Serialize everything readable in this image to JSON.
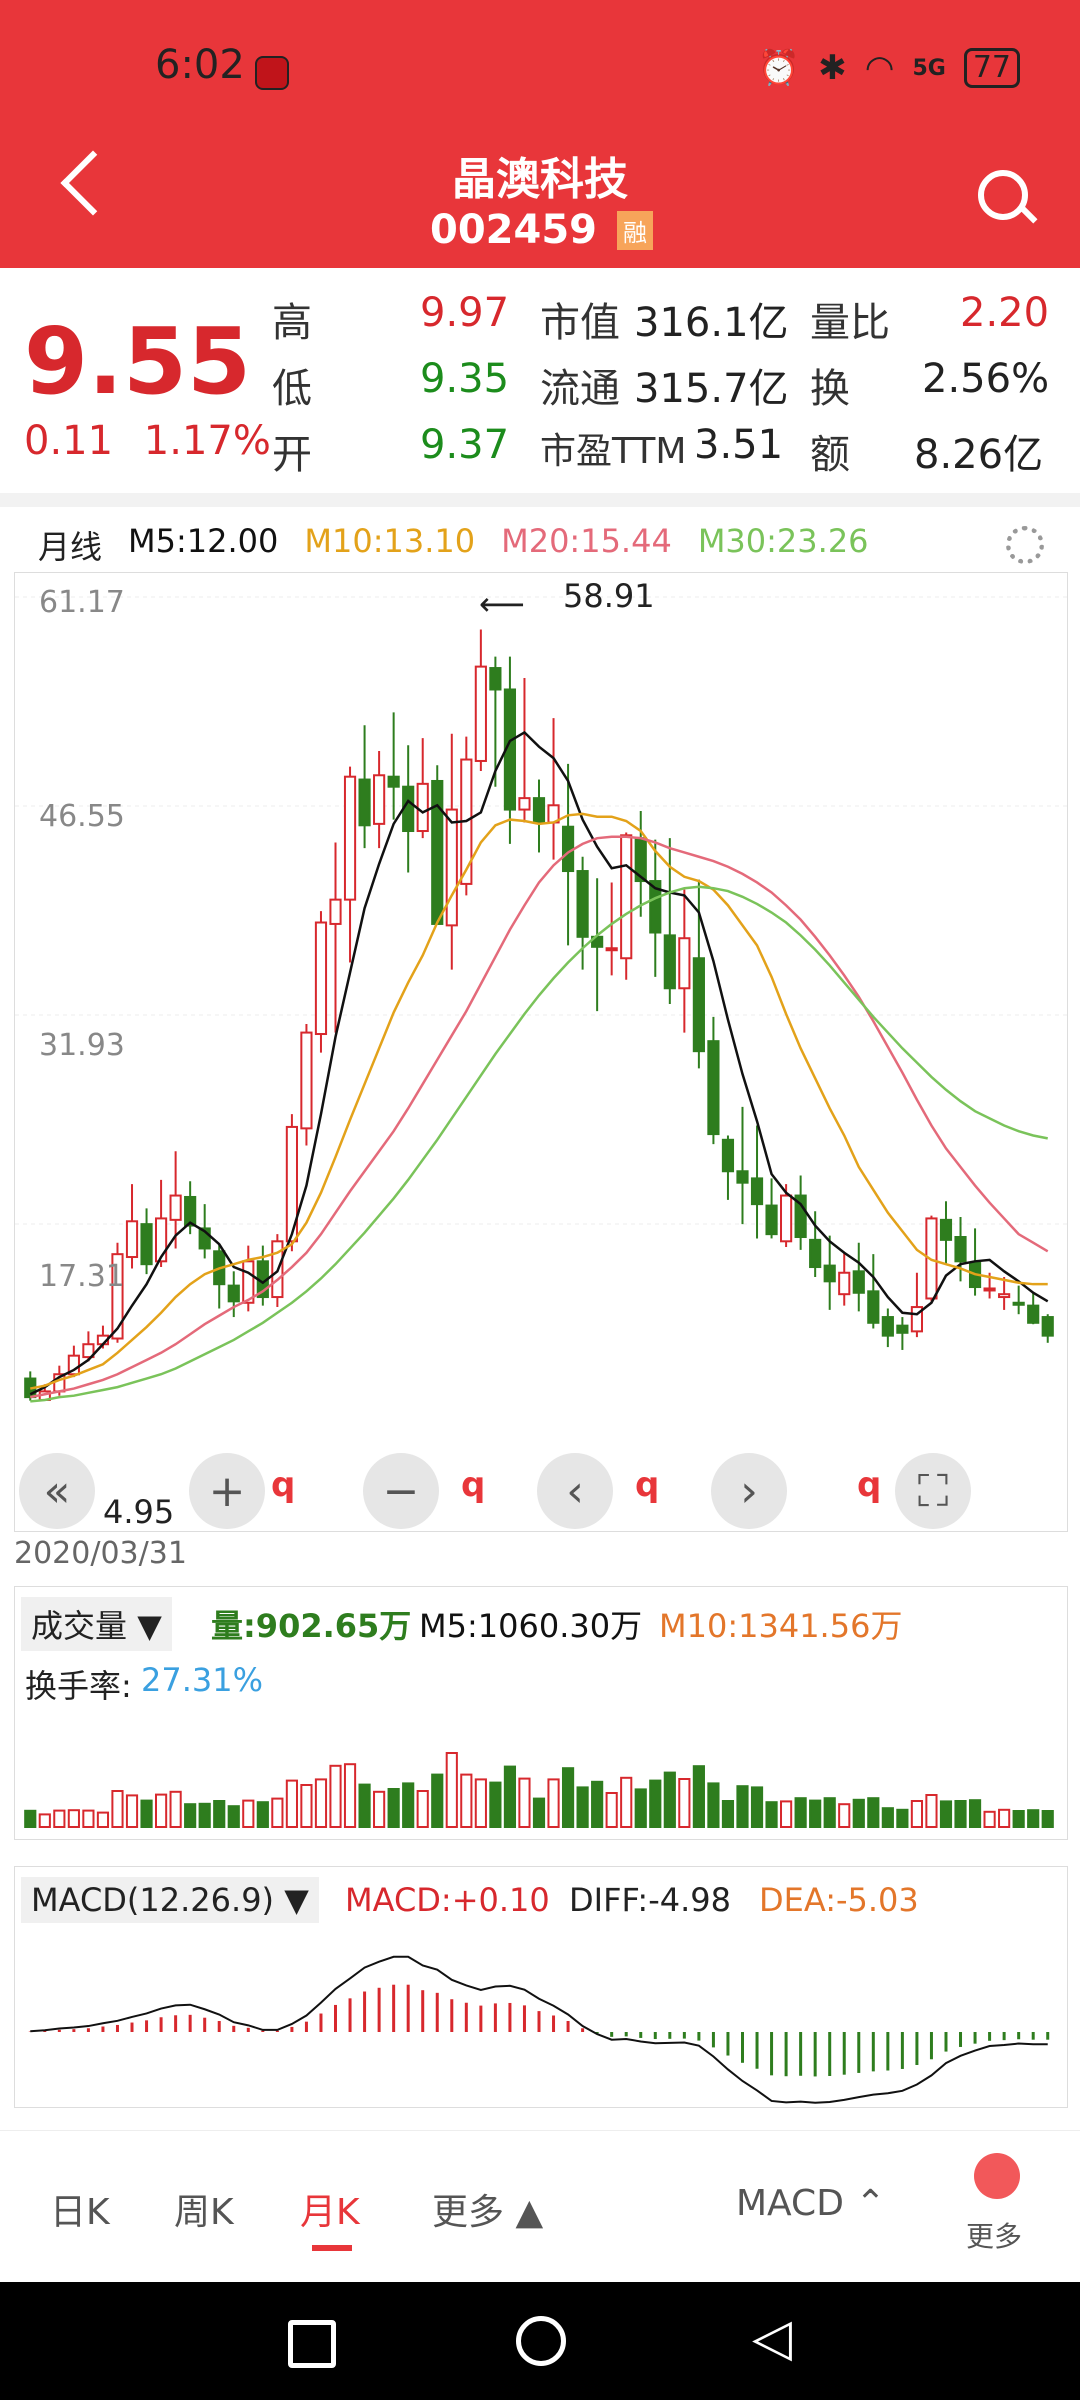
{
  "status_bar": {
    "time": "6:02",
    "signal": "5G",
    "battery": "77"
  },
  "header": {
    "stock_name": "晶澳科技",
    "stock_code": "002459",
    "margin_badge": "融"
  },
  "quote": {
    "price": "9.55",
    "change": "0.11",
    "change_pct": "1.17%",
    "rows": [
      {
        "label": "高",
        "value": "9.97",
        "label2": "市值",
        "value2": "316.1亿",
        "label3": "量比",
        "value3": "2.20"
      },
      {
        "label": "低",
        "value": "9.35",
        "label2": "流通",
        "value2": "315.7亿",
        "label3": "换",
        "value3": "2.56%"
      },
      {
        "label": "开",
        "value": "9.37",
        "label2": "市盈TTM",
        "value2": "3.51",
        "label3": "额",
        "value3": "8.26亿"
      }
    ]
  },
  "ma_row": {
    "period": "月线",
    "m5": "M5:12.00",
    "m10": "M10:13.10",
    "m20": "M20:15.44",
    "m30": "M30:23.26"
  },
  "colors": {
    "red": "#d7282d",
    "green": "#2e7d1e",
    "m5": "#111111",
    "m10": "#e3a21a",
    "m20": "#e46a7a",
    "m30": "#7ac35a"
  },
  "kline": {
    "y_ticks": [
      "61.17",
      "46.55",
      "31.93",
      "17.31"
    ],
    "high_marker": "58.91",
    "low_marker": "4.95",
    "date_label": "2020/03/31"
  },
  "chart_data": {
    "type": "candlestick",
    "title": "月线",
    "ylim": [
      2.69,
      61.17
    ],
    "candles": [
      {
        "o": 6.5,
        "c": 5.2,
        "h": 7.0,
        "l": 4.95
      },
      {
        "o": 5.0,
        "c": 5.6,
        "h": 6.1,
        "l": 4.95
      },
      {
        "o": 5.6,
        "c": 6.8,
        "h": 7.4,
        "l": 5.3
      },
      {
        "o": 6.8,
        "c": 8.1,
        "h": 8.8,
        "l": 6.6
      },
      {
        "o": 8.0,
        "c": 8.9,
        "h": 9.8,
        "l": 7.7
      },
      {
        "o": 8.9,
        "c": 9.5,
        "h": 10.2,
        "l": 8.6
      },
      {
        "o": 9.3,
        "c": 15.2,
        "h": 16.0,
        "l": 9.0
      },
      {
        "o": 15.0,
        "c": 17.5,
        "h": 20.1,
        "l": 14.2
      },
      {
        "o": 17.3,
        "c": 14.5,
        "h": 18.4,
        "l": 13.8
      },
      {
        "o": 14.7,
        "c": 17.7,
        "h": 20.4,
        "l": 14.3
      },
      {
        "o": 17.6,
        "c": 19.3,
        "h": 22.4,
        "l": 15.6
      },
      {
        "o": 19.2,
        "c": 17.2,
        "h": 20.3,
        "l": 16.6
      },
      {
        "o": 17.0,
        "c": 15.6,
        "h": 18.7,
        "l": 14.9
      },
      {
        "o": 15.4,
        "c": 13.1,
        "h": 15.9,
        "l": 11.4
      },
      {
        "o": 13.0,
        "c": 11.9,
        "h": 14.0,
        "l": 10.8
      },
      {
        "o": 11.8,
        "c": 14.7,
        "h": 15.8,
        "l": 11.2
      },
      {
        "o": 14.7,
        "c": 12.2,
        "h": 15.8,
        "l": 11.6
      },
      {
        "o": 12.2,
        "c": 16.1,
        "h": 16.6,
        "l": 11.5
      },
      {
        "o": 16.1,
        "c": 24.1,
        "h": 25.0,
        "l": 15.4
      },
      {
        "o": 24.0,
        "c": 30.7,
        "h": 31.3,
        "l": 22.8
      },
      {
        "o": 30.6,
        "c": 38.4,
        "h": 39.2,
        "l": 29.3
      },
      {
        "o": 38.3,
        "c": 40.0,
        "h": 44.0,
        "l": 30.7
      },
      {
        "o": 40.0,
        "c": 48.6,
        "h": 49.3,
        "l": 35.6
      },
      {
        "o": 48.4,
        "c": 45.2,
        "h": 52.2,
        "l": 43.6
      },
      {
        "o": 45.3,
        "c": 48.7,
        "h": 50.4,
        "l": 43.6
      },
      {
        "o": 48.6,
        "c": 47.9,
        "h": 53.1,
        "l": 45.6
      },
      {
        "o": 47.9,
        "c": 44.8,
        "h": 50.8,
        "l": 41.9
      },
      {
        "o": 44.8,
        "c": 48.1,
        "h": 51.3,
        "l": 44.3
      },
      {
        "o": 48.3,
        "c": 38.3,
        "h": 49.4,
        "l": 38.3
      },
      {
        "o": 38.2,
        "c": 46.3,
        "h": 51.6,
        "l": 35.1
      },
      {
        "o": 41.1,
        "c": 49.8,
        "h": 51.4,
        "l": 40.3
      },
      {
        "o": 49.7,
        "c": 56.3,
        "h": 58.9,
        "l": 49.0
      },
      {
        "o": 56.2,
        "c": 54.7,
        "h": 57.0,
        "l": 47.9
      },
      {
        "o": 54.7,
        "c": 46.3,
        "h": 57.0,
        "l": 43.9
      },
      {
        "o": 46.3,
        "c": 47.1,
        "h": 55.5,
        "l": 45.4
      },
      {
        "o": 47.1,
        "c": 45.4,
        "h": 48.4,
        "l": 43.3
      },
      {
        "o": 45.4,
        "c": 46.6,
        "h": 52.7,
        "l": 42.8
      },
      {
        "o": 45.1,
        "c": 42.0,
        "h": 49.5,
        "l": 36.8
      },
      {
        "o": 42.0,
        "c": 37.4,
        "h": 43.0,
        "l": 35.1
      },
      {
        "o": 37.4,
        "c": 36.7,
        "h": 41.5,
        "l": 32.2
      },
      {
        "o": 36.5,
        "c": 36.6,
        "h": 41.2,
        "l": 34.7
      },
      {
        "o": 35.9,
        "c": 44.5,
        "h": 44.7,
        "l": 34.4
      },
      {
        "o": 44.3,
        "c": 41.3,
        "h": 46.2,
        "l": 38.8
      },
      {
        "o": 41.3,
        "c": 37.7,
        "h": 44.2,
        "l": 34.6
      },
      {
        "o": 37.5,
        "c": 33.8,
        "h": 44.3,
        "l": 32.7
      },
      {
        "o": 33.8,
        "c": 37.3,
        "h": 40.7,
        "l": 30.7
      },
      {
        "o": 35.9,
        "c": 29.4,
        "h": 41.4,
        "l": 28.2
      },
      {
        "o": 30.1,
        "c": 23.6,
        "h": 31.8,
        "l": 22.9
      },
      {
        "o": 23.2,
        "c": 21.0,
        "h": 23.5,
        "l": 19.0
      },
      {
        "o": 21.0,
        "c": 20.2,
        "h": 25.5,
        "l": 17.3
      },
      {
        "o": 20.5,
        "c": 18.7,
        "h": 24.2,
        "l": 16.3
      },
      {
        "o": 18.6,
        "c": 16.6,
        "h": 20.5,
        "l": 16.3
      },
      {
        "o": 16.1,
        "c": 19.3,
        "h": 20.1,
        "l": 15.7
      },
      {
        "o": 19.3,
        "c": 16.4,
        "h": 20.7,
        "l": 15.5
      },
      {
        "o": 16.2,
        "c": 14.3,
        "h": 18.2,
        "l": 13.6
      },
      {
        "o": 14.4,
        "c": 13.3,
        "h": 16.5,
        "l": 11.3
      },
      {
        "o": 12.4,
        "c": 13.9,
        "h": 15.3,
        "l": 11.6
      },
      {
        "o": 14.0,
        "c": 12.5,
        "h": 16.0,
        "l": 11.2
      },
      {
        "o": 12.6,
        "c": 10.4,
        "h": 15.2,
        "l": 10.0
      },
      {
        "o": 10.8,
        "c": 9.5,
        "h": 11.4,
        "l": 8.7
      },
      {
        "o": 10.2,
        "c": 9.7,
        "h": 10.8,
        "l": 8.5
      },
      {
        "o": 9.8,
        "c": 11.5,
        "h": 13.9,
        "l": 9.4
      },
      {
        "o": 12.1,
        "c": 17.7,
        "h": 17.9,
        "l": 11.9
      },
      {
        "o": 17.6,
        "c": 16.2,
        "h": 18.9,
        "l": 14.5
      },
      {
        "o": 16.4,
        "c": 14.7,
        "h": 17.8,
        "l": 13.3
      },
      {
        "o": 14.6,
        "c": 12.9,
        "h": 17.0,
        "l": 12.3
      },
      {
        "o": 12.8,
        "c": 12.8,
        "h": 13.9,
        "l": 12.1
      },
      {
        "o": 12.2,
        "c": 12.4,
        "h": 13.6,
        "l": 11.3
      },
      {
        "o": 11.8,
        "c": 11.7,
        "h": 13.0,
        "l": 11.0
      },
      {
        "o": 11.6,
        "c": 10.4,
        "h": 12.5,
        "l": 10.3
      },
      {
        "o": 10.8,
        "c": 9.5,
        "h": 11.0,
        "l": 9.0
      }
    ],
    "ma_lines": [
      {
        "name": "M5",
        "values": [
          5.4,
          5.9,
          6.6,
          7.1,
          7.8,
          8.9,
          10.0,
          11.6,
          13.1,
          15.0,
          16.5,
          17.4,
          16.8,
          15.9,
          14.3,
          13.9,
          13.2,
          14.0,
          16.6,
          20.0,
          25.0,
          30.4,
          34.9,
          39.4,
          42.5,
          45.3,
          46.9,
          46.1,
          46.6,
          45.4,
          45.5,
          46.1,
          49.0,
          51.1,
          51.7,
          50.7,
          49.9,
          48.3,
          45.6,
          43.7,
          42.2,
          42.4,
          41.6,
          40.8,
          40.5,
          40.3,
          39.1,
          35.7,
          31.6,
          27.8,
          24.5,
          20.8,
          19.5,
          18.7,
          17.2,
          16.1,
          15.3,
          14.6,
          13.6,
          12.2,
          11.1,
          11.0,
          11.8,
          13.7,
          14.5,
          14.7,
          14.8,
          14.0,
          13.3,
          12.5,
          11.9
        ]
      },
      {
        "name": "M10",
        "values": [
          5.8,
          6.0,
          6.4,
          6.7,
          7.1,
          7.5,
          8.3,
          9.2,
          10.1,
          11.1,
          12.2,
          13.1,
          13.8,
          14.2,
          14.5,
          14.8,
          15.0,
          15.3,
          15.9,
          17.4,
          19.5,
          22.0,
          24.6,
          27.1,
          29.6,
          32.1,
          34.2,
          36.1,
          38.4,
          40.3,
          42.1,
          44.0,
          45.2,
          45.6,
          45.5,
          45.3,
          45.4,
          45.9,
          46.0,
          45.8,
          45.8,
          45.5,
          44.8,
          43.4,
          42.3,
          41.6,
          41.3,
          40.7,
          39.6,
          38.2,
          36.8,
          34.6,
          32.0,
          29.6,
          27.5,
          25.4,
          23.5,
          21.3,
          19.7,
          18.1,
          16.8,
          15.5,
          14.8,
          14.5,
          14.2,
          13.8,
          13.6,
          13.4,
          13.2,
          13.1,
          13.1
        ]
      },
      {
        "name": "M20",
        "values": [
          5.2,
          5.4,
          5.6,
          5.8,
          6.1,
          6.4,
          6.8,
          7.3,
          7.8,
          8.3,
          8.9,
          9.6,
          10.3,
          10.9,
          11.5,
          12.0,
          12.6,
          13.4,
          14.3,
          15.3,
          16.6,
          18.1,
          19.6,
          21.0,
          22.4,
          23.8,
          25.4,
          27.1,
          28.8,
          30.5,
          32.2,
          34.1,
          36.0,
          37.9,
          39.6,
          41.2,
          42.4,
          43.3,
          43.9,
          44.3,
          44.4,
          44.4,
          44.3,
          44.0,
          43.6,
          43.3,
          43.0,
          42.7,
          42.3,
          41.8,
          41.2,
          40.5,
          39.6,
          38.6,
          37.4,
          36.1,
          34.7,
          33.2,
          31.5,
          29.7,
          27.9,
          26.0,
          24.2,
          22.6,
          21.3,
          20.0,
          18.8,
          17.7,
          16.6,
          16.0,
          15.4
        ]
      },
      {
        "name": "M30",
        "values": [
          4.9,
          5.0,
          5.2,
          5.3,
          5.5,
          5.7,
          5.9,
          6.2,
          6.5,
          6.8,
          7.2,
          7.7,
          8.2,
          8.7,
          9.2,
          9.8,
          10.4,
          11.1,
          11.8,
          12.6,
          13.5,
          14.5,
          15.6,
          16.7,
          17.9,
          19.1,
          20.4,
          21.8,
          23.2,
          24.7,
          26.2,
          27.7,
          29.2,
          30.6,
          32.0,
          33.3,
          34.5,
          35.6,
          36.6,
          37.5,
          38.3,
          39.0,
          39.6,
          40.1,
          40.5,
          40.8,
          40.9,
          40.8,
          40.6,
          40.2,
          39.7,
          39.1,
          38.4,
          37.5,
          36.5,
          35.4,
          34.2,
          33.0,
          31.8,
          30.7,
          29.6,
          28.6,
          27.6,
          26.7,
          25.9,
          25.2,
          24.7,
          24.2,
          23.8,
          23.5,
          23.3
        ]
      }
    ],
    "volume": {
      "label": "成交量",
      "volume_value": "量:902.65万",
      "m5": "M5:1060.30万",
      "m10": "M10:1341.56万",
      "turnover_label": "换手率:",
      "turnover_value": "27.31%"
    },
    "macd": {
      "label": "MACD(12.26.9)",
      "macd_value": "MACD:+0.10",
      "diff": "DIFF:-4.98",
      "dea": "DEA:-5.03"
    }
  },
  "bottom_nav": {
    "tabs": [
      "日K",
      "周K",
      "月K",
      "更多"
    ],
    "active": "月K",
    "indicator": "MACD",
    "more": "更多"
  }
}
